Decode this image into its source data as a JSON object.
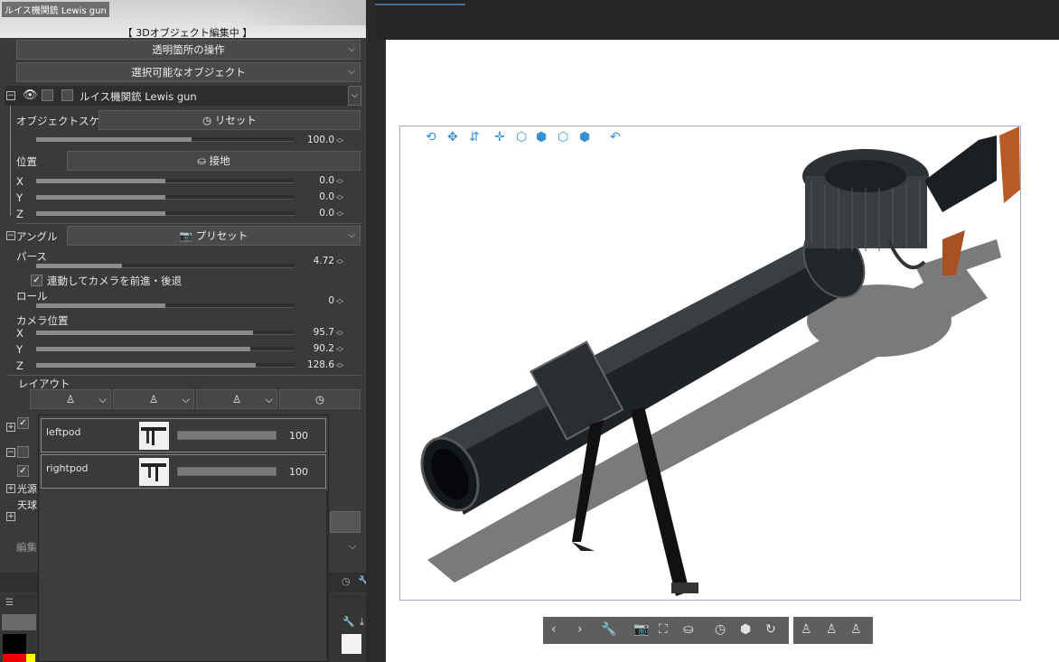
{
  "window": {
    "title_tag": "ルイス機関銃 Lewis gun",
    "editing_label": "【 3Dオブジェクト編集中 】"
  },
  "dropdowns": {
    "transparent_ops": "透明箇所の操作",
    "selectable_objects": "選択可能なオブジェクト"
  },
  "object": {
    "name": "ルイス機関銃 Lewis gun"
  },
  "scale": {
    "label": "オブジェクトスケール",
    "reset_label": "リセット",
    "value": "100.0",
    "fraction": 0.61
  },
  "position": {
    "label": "位置",
    "ground_label": "接地",
    "x": {
      "label": "X",
      "value": "0.0",
      "fraction": 0.5
    },
    "y": {
      "label": "Y",
      "value": "0.0",
      "fraction": 0.5
    },
    "z": {
      "label": "Z",
      "value": "0.0",
      "fraction": 0.5
    }
  },
  "angle": {
    "label": "アングル",
    "preset_label": "プリセット",
    "perspective": {
      "label": "パース",
      "value": "4.72",
      "fraction": 0.33
    },
    "camera_follow": {
      "label": "連動してカメラを前進・後退",
      "checked": true
    },
    "roll": {
      "label": "ロール",
      "value": "0",
      "fraction": 0.5
    },
    "camera_pos": {
      "label": "カメラ位置",
      "x": {
        "label": "X",
        "value": "95.7",
        "fraction": 0.84
      },
      "y": {
        "label": "Y",
        "value": "90.2",
        "fraction": 0.83
      },
      "z": {
        "label": "Z",
        "value": "128.6",
        "fraction": 0.85
      }
    }
  },
  "layout": {
    "label": "レイアウト"
  },
  "popup": {
    "rows": [
      {
        "name": "leftpod",
        "value": "100",
        "fraction": 1.0
      },
      {
        "name": "rightpod",
        "value": "100",
        "fraction": 1.0
      }
    ]
  },
  "hidden_labels": {
    "light": "光源",
    "sky": "天球",
    "edit": "編集"
  },
  "viewport": {
    "border_color": "#a5a5d0",
    "icon_color": "#3a8fd0"
  }
}
